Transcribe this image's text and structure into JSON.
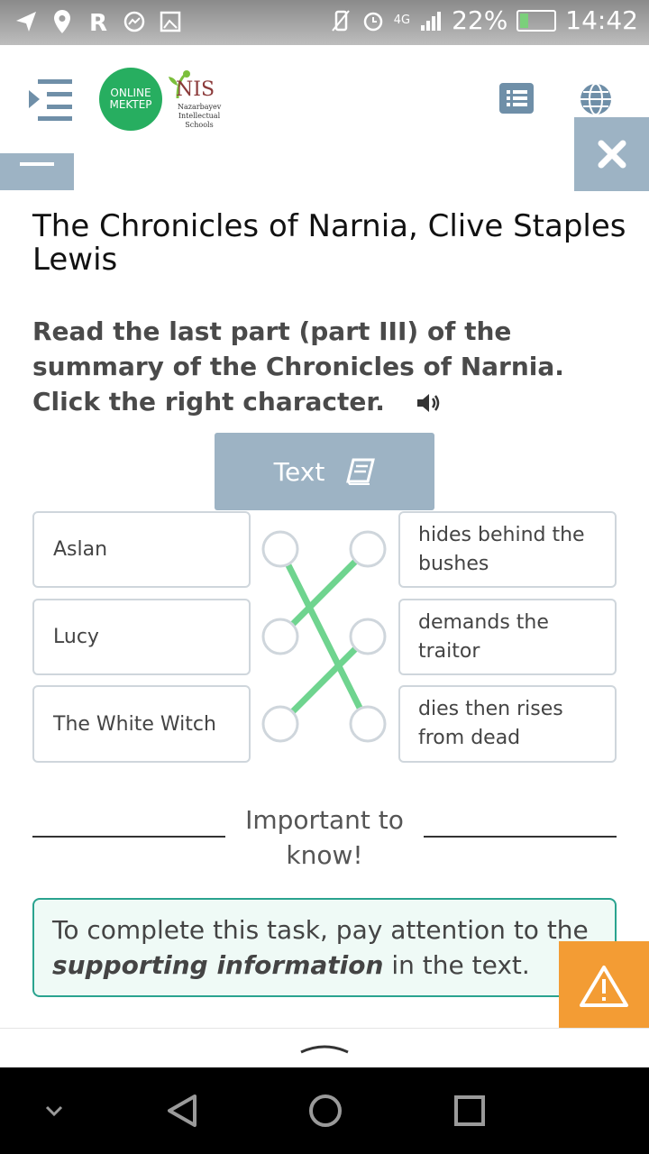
{
  "status_bar": {
    "network": "4G",
    "battery": "22%",
    "time": "14:42"
  },
  "header": {
    "logo_line1": "ONLINE",
    "logo_line2": "MEKTEP",
    "nis_title": "NIS",
    "nis_subtitle": "Nazarbayev Intellectual Schools"
  },
  "page": {
    "title": "The Chronicles of Narnia, Clive Staples Lewis",
    "instruction": "Read the last part (part III) of the summary of the Chronicles of Narnia. Click the right character.",
    "text_button_label": "Text"
  },
  "matching": {
    "left_items": [
      "Aslan",
      "Lucy",
      "The White Witch"
    ],
    "right_items": [
      "hides behind the bushes",
      "demands the traitor",
      "dies then rises from dead"
    ],
    "connections": [
      {
        "from": "Aslan",
        "to": "dies then rises from dead"
      },
      {
        "from": "Lucy",
        "to": "hides behind the bushes"
      },
      {
        "from": "The White Witch",
        "to": "demands the traitor"
      }
    ],
    "line_color": "#6fd48f"
  },
  "important": {
    "label": "Important to know!",
    "text_before": "To complete this task, pay attention to the ",
    "text_emphasis": "supporting information",
    "text_after": " in the text."
  },
  "colors": {
    "accent_blue": "#9db3c4",
    "warning_orange": "#f39c34",
    "info_border": "#2aa38f"
  }
}
